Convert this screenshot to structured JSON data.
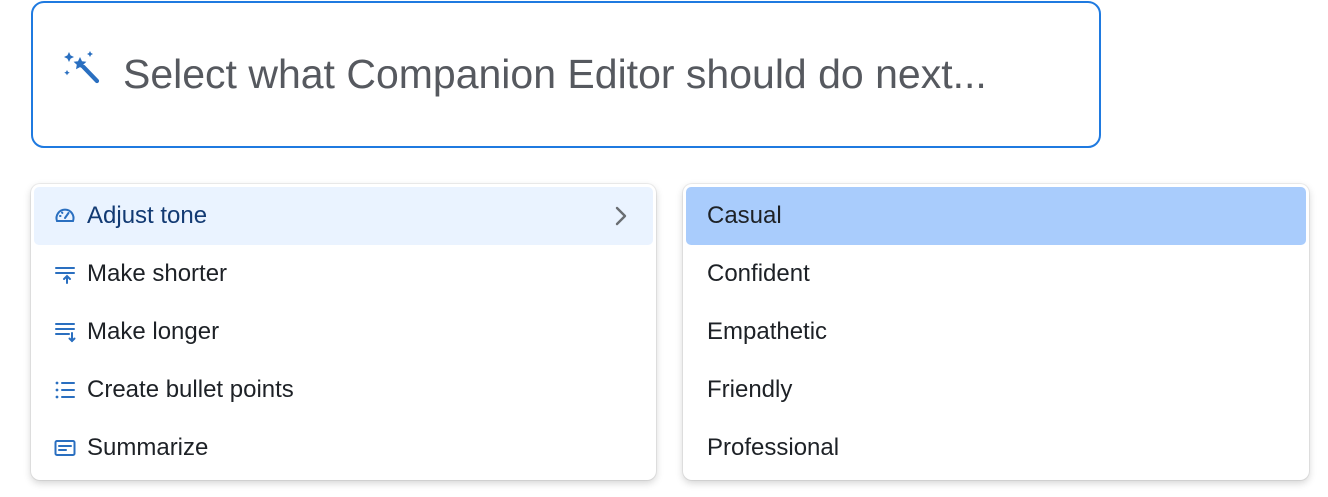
{
  "prompt": {
    "placeholder": "Select what Companion Editor should do next...",
    "icon": "magic-wand-icon"
  },
  "actions_menu": {
    "items": [
      {
        "label": "Adjust tone",
        "icon": "gauge-icon",
        "active": true,
        "has_submenu": true
      },
      {
        "label": "Make shorter",
        "icon": "make-shorter-icon"
      },
      {
        "label": "Make longer",
        "icon": "make-longer-icon"
      },
      {
        "label": "Create bullet points",
        "icon": "bullet-list-icon"
      },
      {
        "label": "Summarize",
        "icon": "summarize-icon"
      }
    ]
  },
  "tone_menu": {
    "items": [
      {
        "label": "Casual",
        "selected": true
      },
      {
        "label": "Confident"
      },
      {
        "label": "Empathetic"
      },
      {
        "label": "Friendly"
      },
      {
        "label": "Professional"
      }
    ]
  },
  "colors": {
    "accent_border": "#1f7ae0",
    "icon_blue": "#2a6fc0",
    "active_bg": "#eaf3ff",
    "selected_bg": "#a9ccfc"
  }
}
